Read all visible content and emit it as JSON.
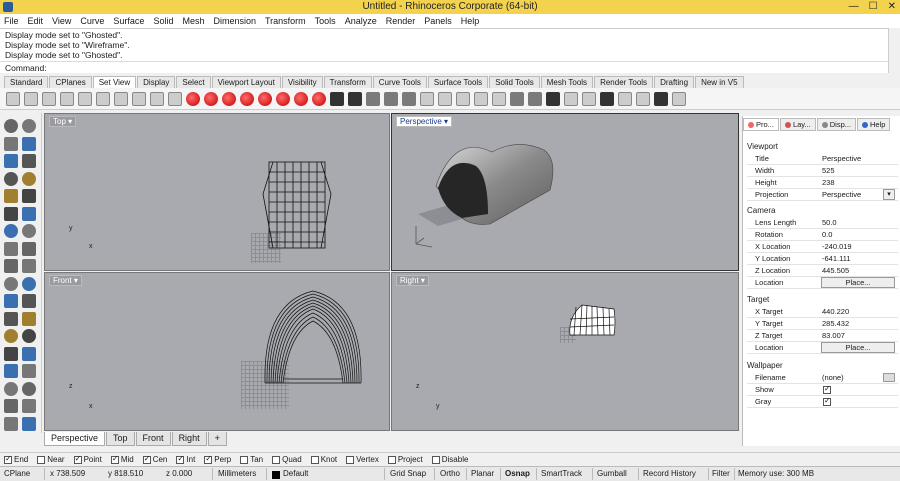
{
  "window": {
    "title": "Untitled - Rhinoceros Corporate (64-bit)"
  },
  "menu": [
    "File",
    "Edit",
    "View",
    "Curve",
    "Surface",
    "Solid",
    "Mesh",
    "Dimension",
    "Transform",
    "Tools",
    "Analyze",
    "Render",
    "Panels",
    "Help"
  ],
  "history": [
    "Display mode set to \"Ghosted\".",
    "Display mode set to \"Wireframe\".",
    "Display mode set to \"Ghosted\"."
  ],
  "command": {
    "prompt": "Command:"
  },
  "toolbar_tabs": [
    "Standard",
    "CPlanes",
    "Set View",
    "Display",
    "Select",
    "Viewport Layout",
    "Visibility",
    "Transform",
    "Curve Tools",
    "Surface Tools",
    "Solid Tools",
    "Mesh Tools",
    "Render Tools",
    "Drafting",
    "New in V5"
  ],
  "viewports": {
    "top": "Top",
    "perspective": "Perspective",
    "front": "Front",
    "right": "Right"
  },
  "vp_tabs": [
    "Perspective",
    "Top",
    "Front",
    "Right"
  ],
  "osnaps": [
    {
      "label": "End",
      "checked": true
    },
    {
      "label": "Near",
      "checked": false
    },
    {
      "label": "Point",
      "checked": true
    },
    {
      "label": "Mid",
      "checked": true
    },
    {
      "label": "Cen",
      "checked": true
    },
    {
      "label": "Int",
      "checked": true
    },
    {
      "label": "Perp",
      "checked": true
    },
    {
      "label": "Tan",
      "checked": false
    },
    {
      "label": "Quad",
      "checked": false
    },
    {
      "label": "Knot",
      "checked": false
    },
    {
      "label": "Vertex",
      "checked": false
    },
    {
      "label": "Project",
      "checked": false
    },
    {
      "label": "Disable",
      "checked": false
    }
  ],
  "status": {
    "cplane": "CPlane",
    "x": "x 738.509",
    "y": "y 818.510",
    "z": "z 0.000",
    "units": "Millimeters",
    "layer": "Default",
    "grid_snap": "Grid Snap",
    "ortho": "Ortho",
    "planar": "Planar",
    "osnap": "Osnap",
    "smarttrack": "SmartTrack",
    "gumball": "Gumball",
    "record_history": "Record History",
    "filter": "Filter",
    "memory": "Memory use: 300 MB"
  },
  "panel": {
    "tabs": [
      "Pro...",
      "Lay...",
      "Disp...",
      "Help"
    ],
    "viewport": {
      "title": "Viewport",
      "rows": [
        [
          "Title",
          "Perspective"
        ],
        [
          "Width",
          "525"
        ],
        [
          "Height",
          "238"
        ],
        [
          "Projection",
          "Perspective"
        ]
      ]
    },
    "camera": {
      "title": "Camera",
      "rows": [
        [
          "Lens Length",
          "50.0"
        ],
        [
          "Rotation",
          "0.0"
        ],
        [
          "X Location",
          "-240.019"
        ],
        [
          "Y Location",
          "-641.111"
        ],
        [
          "Z Location",
          "445.505"
        ]
      ],
      "location_label": "Location",
      "place": "Place..."
    },
    "target": {
      "title": "Target",
      "rows": [
        [
          "X Target",
          "440.220"
        ],
        [
          "Y Target",
          "285.432"
        ],
        [
          "Z Target",
          "83.007"
        ]
      ],
      "location_label": "Location",
      "place": "Place..."
    },
    "wallpaper": {
      "title": "Wallpaper",
      "rows": [
        [
          "Filename",
          "(none)"
        ]
      ],
      "show_label": "Show",
      "gray_label": "Gray"
    }
  }
}
